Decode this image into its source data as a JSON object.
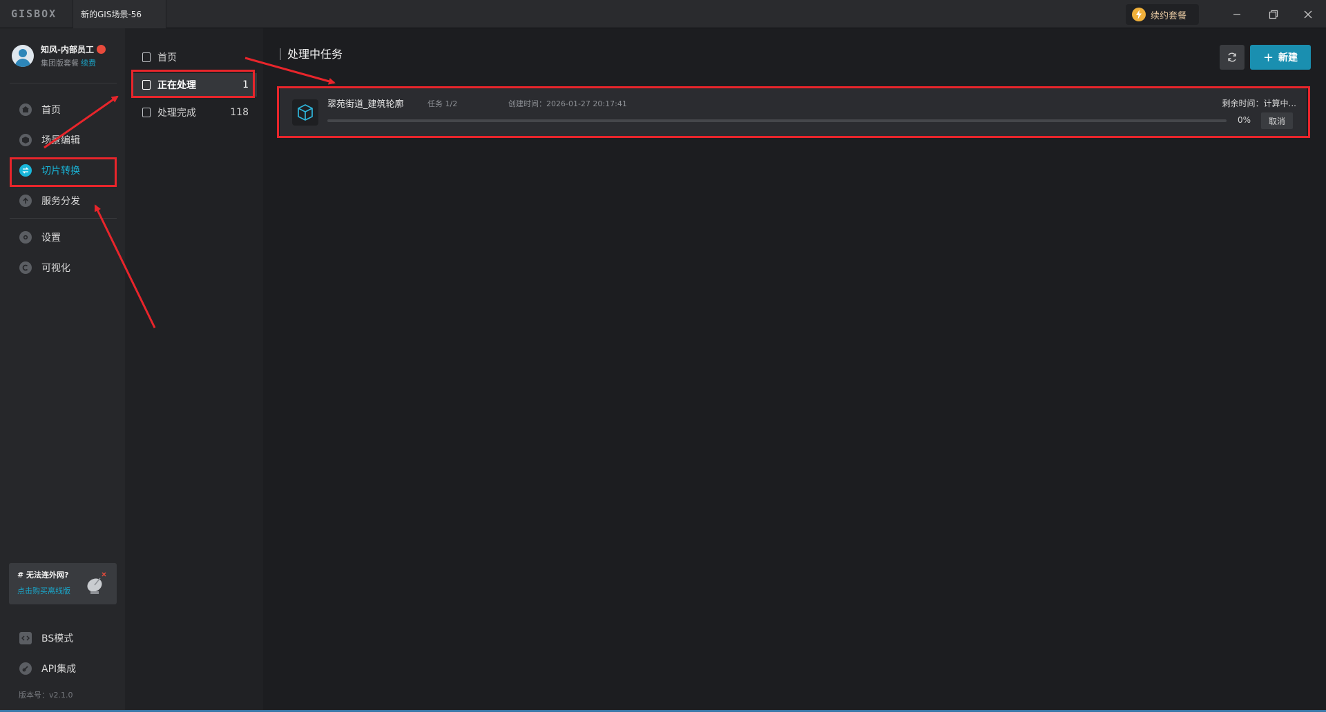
{
  "titlebar": {
    "logo": "GISBOX",
    "doc_tab": "新的GIS场景-56",
    "renew_label": "续约套餐"
  },
  "user": {
    "name": "知风-内部员工",
    "plan": "集团版套餐",
    "renew_link": "续费"
  },
  "sidebar": {
    "items": [
      {
        "label": "首页",
        "icon": "home-icon"
      },
      {
        "label": "场景编辑",
        "icon": "cube-icon"
      },
      {
        "label": "切片转换",
        "icon": "convert-icon",
        "active": true
      },
      {
        "label": "服务分发",
        "icon": "upload-icon"
      },
      {
        "label": "设置",
        "icon": "gear-icon"
      },
      {
        "label": "可视化",
        "icon": "visual-icon"
      }
    ],
    "bottom_items": [
      {
        "label": "BS模式",
        "icon": "code-icon"
      },
      {
        "label": "API集成",
        "icon": "link-icon"
      }
    ],
    "offline": {
      "title": "# 无法连外网?",
      "link": "点击购买离线版"
    },
    "version": "版本号：v2.1.0"
  },
  "subnav": {
    "items": [
      {
        "label": "首页",
        "count": ""
      },
      {
        "label": "正在处理",
        "count": "1",
        "active": true
      },
      {
        "label": "处理完成",
        "count": "118"
      }
    ]
  },
  "main": {
    "section_title": "处理中任务",
    "new_label": "新建",
    "tasks": [
      {
        "name": "翠苑街道_建筑轮廓",
        "step": "任务 1/2",
        "created": "创建时间：2026-01-27 20:17:41",
        "remaining": "剩余时间：计算中...",
        "progress_text": "0%",
        "progress": 0,
        "cancel_label": "取消"
      }
    ]
  },
  "colors": {
    "accent": "#19b6d9",
    "primary_button": "#1a8fb0",
    "highlight": "#e8252b"
  }
}
